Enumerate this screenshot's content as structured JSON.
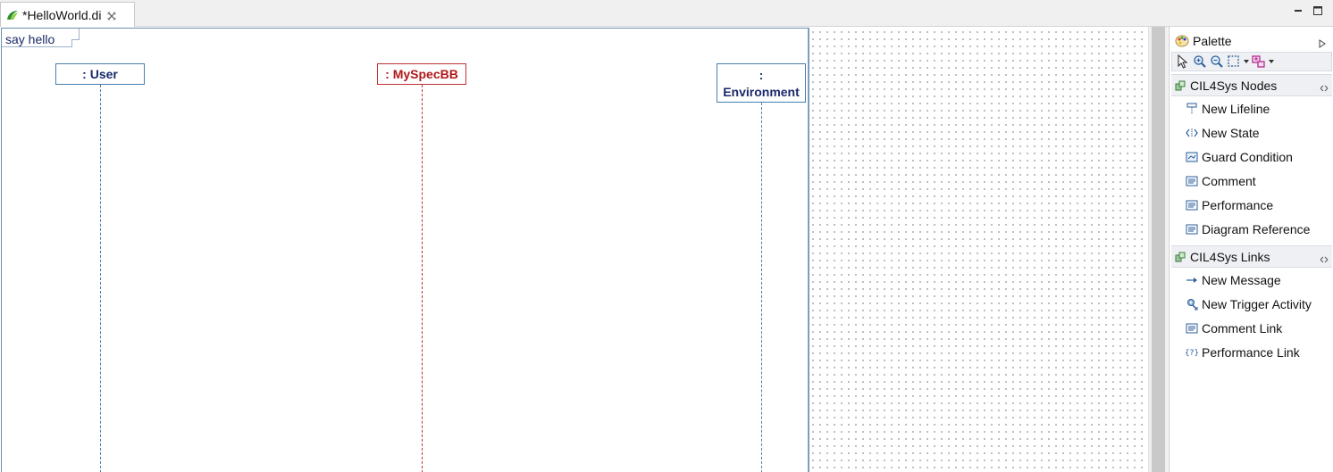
{
  "editor": {
    "tab_title": "*HelloWorld.di"
  },
  "diagram": {
    "frame_label": "say hello",
    "lifelines": [
      {
        "name": ": User",
        "color": "#4a7fb0"
      },
      {
        "name": ": MySpecBB",
        "color": "#c03030"
      },
      {
        "name_line1": ":",
        "name_line2": "Environment",
        "color": "#4a7fb0"
      }
    ]
  },
  "palette": {
    "title": "Palette",
    "drawers": [
      {
        "label": "CIL4Sys Nodes",
        "items": [
          {
            "label": "New Lifeline",
            "icon": "lifeline-icon"
          },
          {
            "label": "New State",
            "icon": "state-icon"
          },
          {
            "label": "Guard Condition",
            "icon": "guard-icon"
          },
          {
            "label": "Comment",
            "icon": "comment-icon"
          },
          {
            "label": "Performance",
            "icon": "comment-icon"
          },
          {
            "label": "Diagram Reference",
            "icon": "comment-icon"
          }
        ]
      },
      {
        "label": "CIL4Sys Links",
        "items": [
          {
            "label": "New Message",
            "icon": "arrow-right-icon"
          },
          {
            "label": "New Trigger Activity",
            "icon": "gear-icon"
          },
          {
            "label": "Comment Link",
            "icon": "comment-icon"
          },
          {
            "label": "Performance Link",
            "icon": "braces-question-icon"
          }
        ]
      }
    ]
  },
  "colors": {
    "accent_blue": "#4a7fb0",
    "accent_red": "#c03030",
    "palette_drawer_bg": "#eef0f3"
  }
}
